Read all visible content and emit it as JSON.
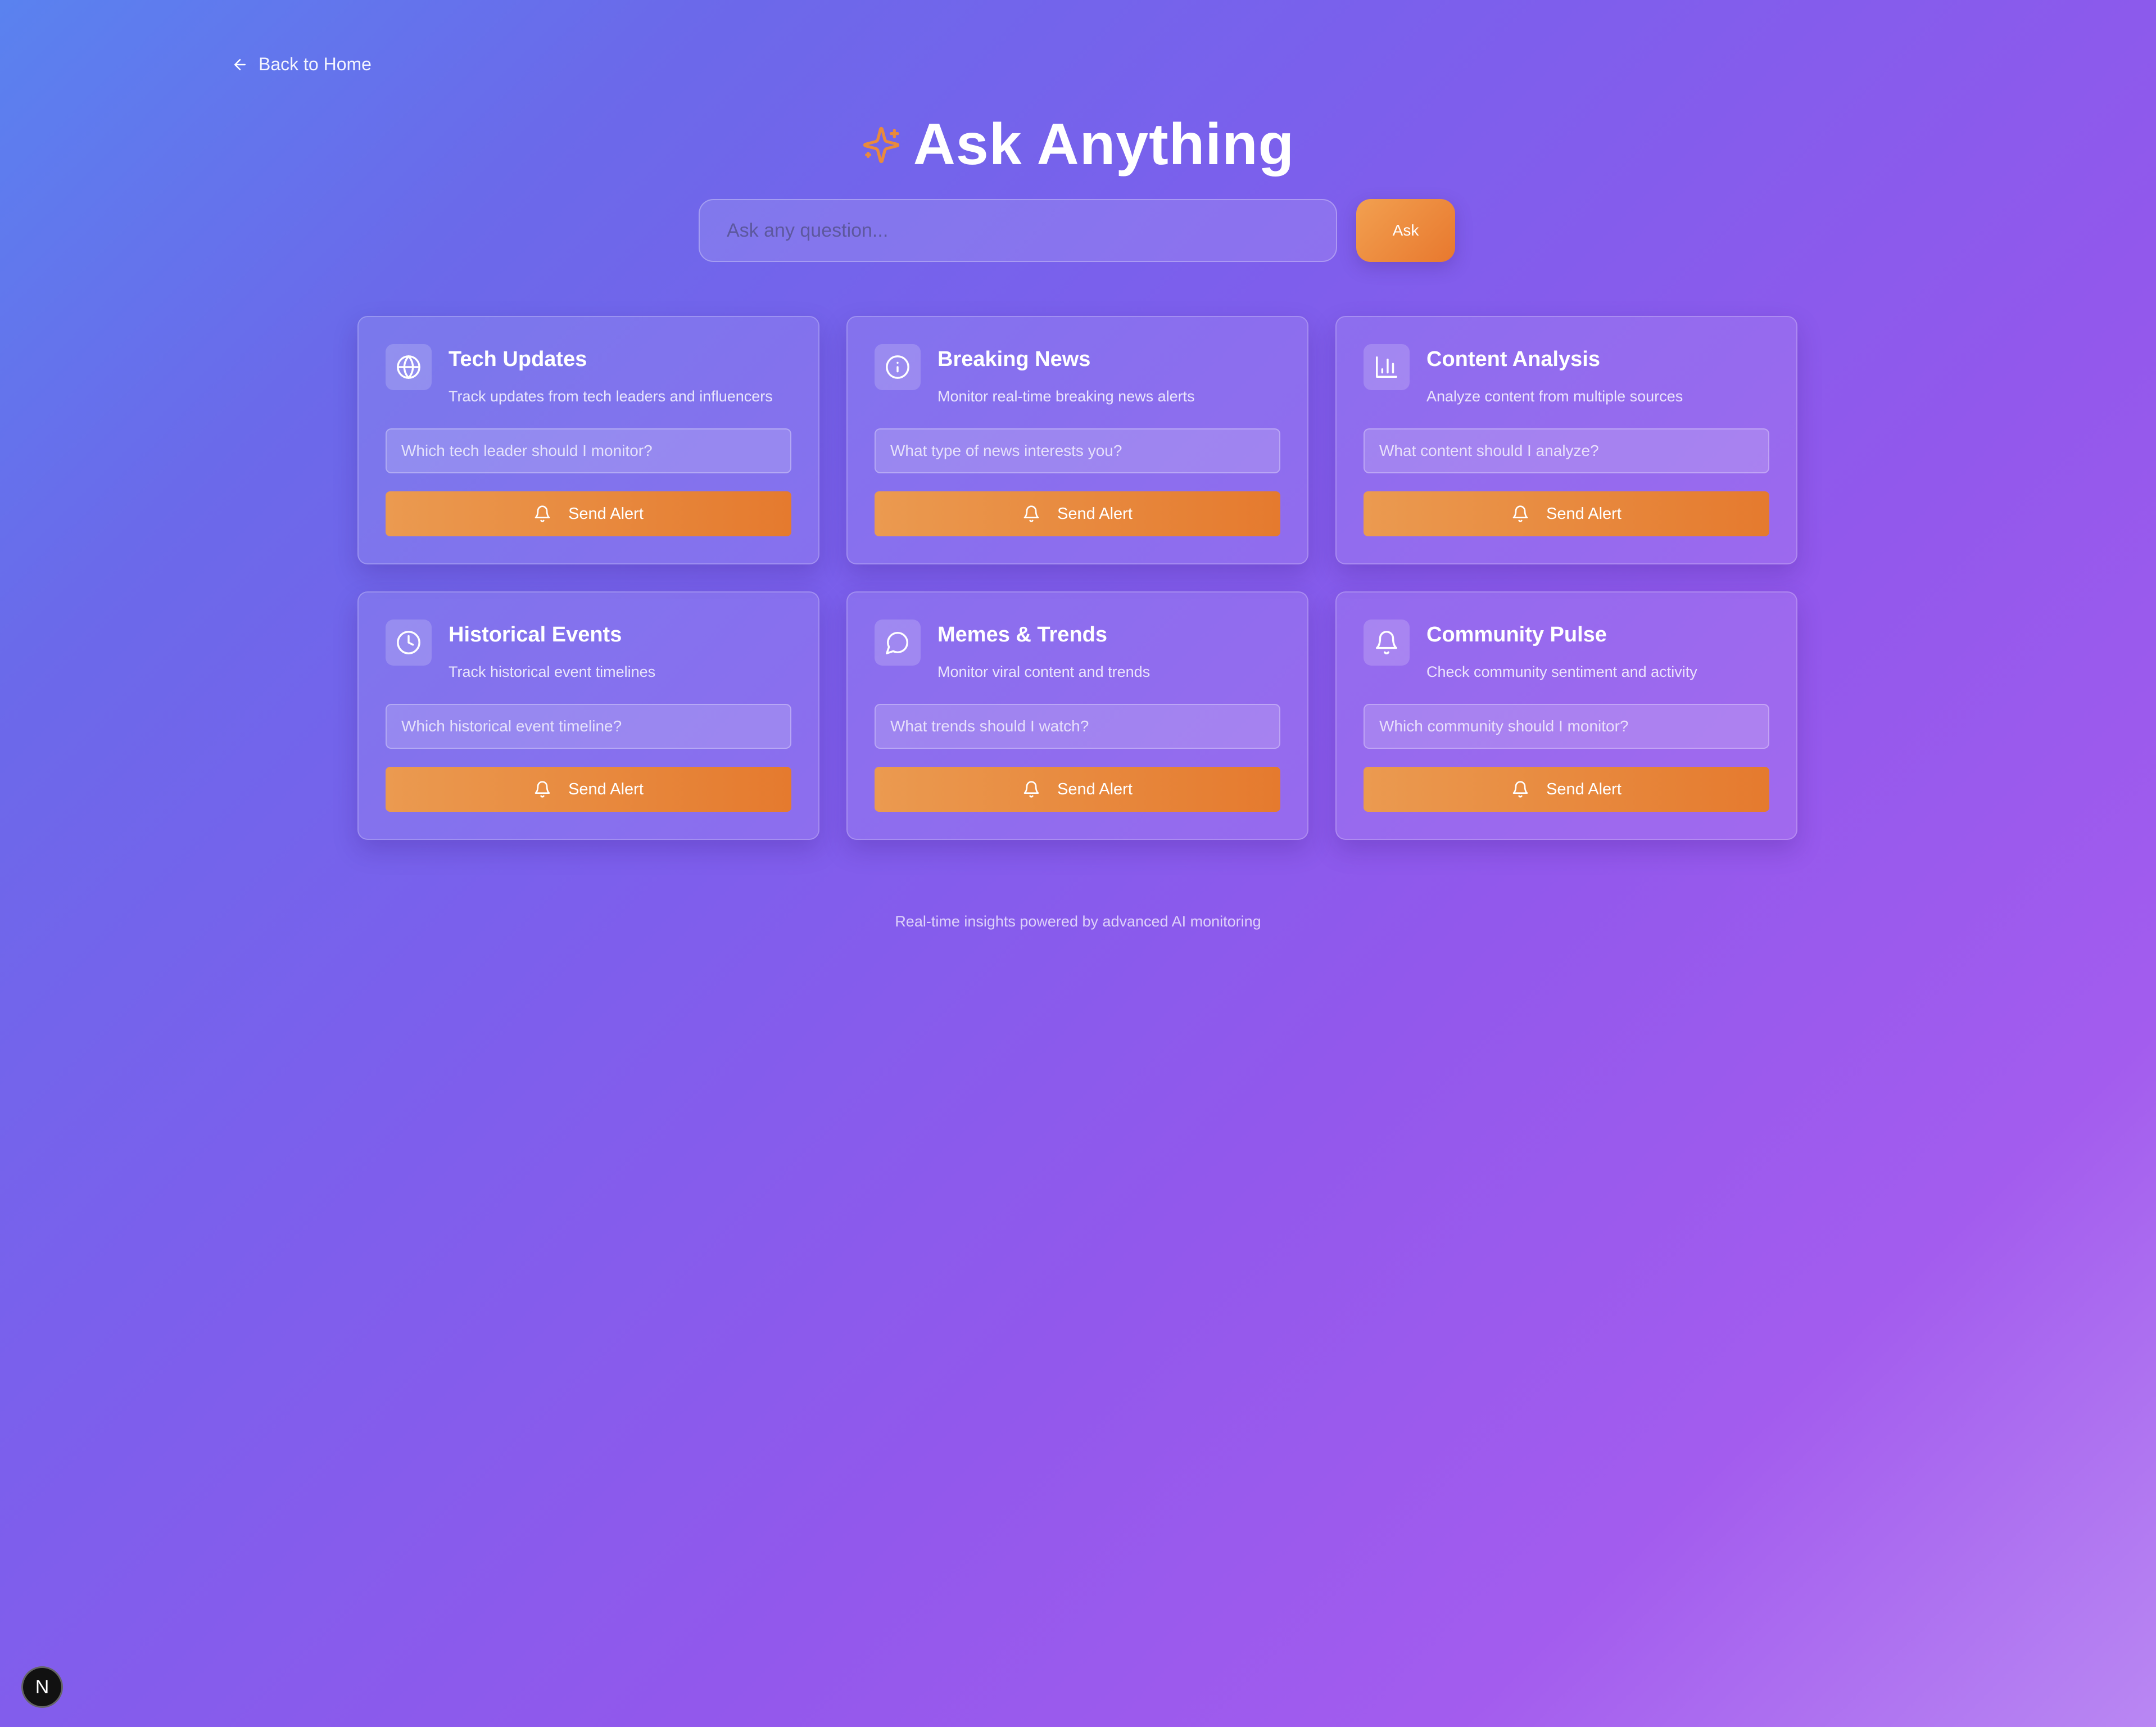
{
  "nav": {
    "back_label": "Back to Home"
  },
  "header": {
    "title": "Ask Anything",
    "sparkle_icon": "sparkles-icon",
    "accent_color": "#e98a3c"
  },
  "search": {
    "placeholder": "Ask any question...",
    "value": "",
    "button_label": "Ask"
  },
  "cards": [
    {
      "title": "Tech Updates",
      "description": "Track updates from tech leaders and influencers",
      "placeholder": "Which tech leader should I monitor?",
      "button_label": "Send Alert",
      "icon": "globe-icon"
    },
    {
      "title": "Breaking News",
      "description": "Monitor real-time breaking news alerts",
      "placeholder": "What type of news interests you?",
      "button_label": "Send Alert",
      "icon": "info-icon"
    },
    {
      "title": "Content Analysis",
      "description": "Analyze content from multiple sources",
      "placeholder": "What content should I analyze?",
      "button_label": "Send Alert",
      "icon": "bar-chart-icon"
    },
    {
      "title": "Historical Events",
      "description": "Track historical event timelines",
      "placeholder": "Which historical event timeline?",
      "button_label": "Send Alert",
      "icon": "clock-icon"
    },
    {
      "title": "Memes & Trends",
      "description": "Monitor viral content and trends",
      "placeholder": "What trends should I watch?",
      "button_label": "Send Alert",
      "icon": "message-circle-icon"
    },
    {
      "title": "Community Pulse",
      "description": "Check community sentiment and activity",
      "placeholder": "Which community should I monitor?",
      "button_label": "Send Alert",
      "icon": "bell-icon"
    }
  ],
  "footer": {
    "text": "Real-time insights powered by advanced AI monitoring"
  },
  "dev_badge": {
    "label": "N"
  },
  "colors": {
    "button_orange": "#e8802f",
    "background_start": "#5a82ef",
    "background_end": "#b987f3"
  }
}
